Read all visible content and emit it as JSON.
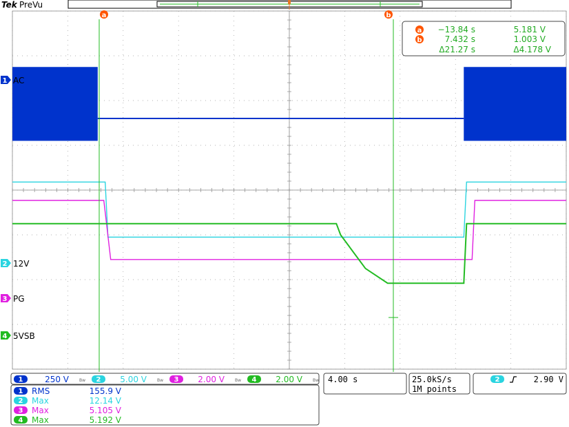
{
  "brand": "Tek",
  "mode": "PreVu",
  "cursors": {
    "a": {
      "label": "a",
      "time": "−13.84 s",
      "value": "5.181 V"
    },
    "b": {
      "label": "b",
      "time": "7.432 s",
      "value": "1.003 V"
    },
    "delta": {
      "time": "Δ21.27 s",
      "value": "Δ4.178 V"
    }
  },
  "channels": [
    {
      "num": "1",
      "label": "AC",
      "color": "#0033cc",
      "scale": "250 V"
    },
    {
      "num": "2",
      "label": "12V",
      "color": "#2ad4e0",
      "scale": "5.00 V"
    },
    {
      "num": "3",
      "label": "PG",
      "color": "#e020e0",
      "scale": "2.00 V"
    },
    {
      "num": "4",
      "label": "5VSB",
      "color": "#22bb22",
      "scale": "2.00 V"
    }
  ],
  "bw_symbol": "Bw",
  "timebase": "4.00 s",
  "sample_rate": "25.0kS/s",
  "record_length": "1M points",
  "trigger": {
    "channel": "2",
    "slope_icon": "rising-edge",
    "level": "2.90 V"
  },
  "measurements": [
    {
      "channel": "1",
      "type": "RMS",
      "value": "155.9 V"
    },
    {
      "channel": "2",
      "type": "Max",
      "value": "12.14 V"
    },
    {
      "channel": "3",
      "type": "Max",
      "value": "5.105 V"
    },
    {
      "channel": "4",
      "type": "Max",
      "value": "5.192 V"
    }
  ],
  "chart_data": {
    "type": "line",
    "xlabel": "",
    "ylabel": "",
    "x_unit": "s",
    "xlim": [
      -20,
      20
    ],
    "ylim_div": [
      -4,
      4
    ],
    "grid": true,
    "series": [
      {
        "name": "AC",
        "segments": [
          {
            "kind": "band",
            "x": [
              -20,
              -13.84
            ],
            "y": [
              1.1,
              2.75
            ]
          },
          {
            "kind": "line",
            "x": [
              -13.84,
              12.6
            ],
            "y": [
              1.6,
              1.6
            ]
          },
          {
            "kind": "band",
            "x": [
              12.6,
              20
            ],
            "y": [
              1.1,
              2.75
            ]
          }
        ]
      },
      {
        "name": "12V",
        "x": [
          -20,
          -13.3,
          -13.1,
          12.6,
          12.8,
          20
        ],
        "y": [
          0.18,
          0.18,
          -1.05,
          -1.05,
          0.18,
          0.18
        ]
      },
      {
        "name": "PG",
        "x": [
          -20,
          -13.4,
          -12.9,
          13.2,
          13.4,
          20
        ],
        "y": [
          -0.23,
          -0.23,
          -1.55,
          -1.55,
          -0.23,
          -0.23
        ]
      },
      {
        "name": "5VSB",
        "x": [
          -20,
          3.4,
          3.7,
          5.5,
          7.1,
          12.6,
          12.8,
          20
        ],
        "y": [
          -0.75,
          -0.75,
          -1.0,
          -1.75,
          -2.08,
          -2.08,
          -0.75,
          -0.75
        ]
      }
    ]
  }
}
